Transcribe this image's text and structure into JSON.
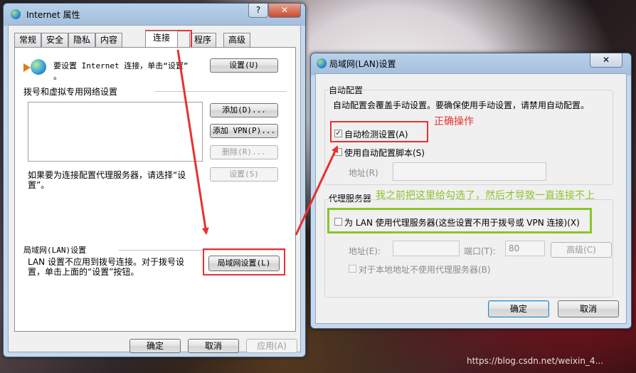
{
  "internet_props": {
    "title": "Internet 属性",
    "help_btn": "?",
    "close_btn": "✕",
    "tabs": [
      "常规",
      "安全",
      "隐私",
      "内容",
      "连接",
      "程序",
      "高级"
    ],
    "setup_text_line1": "要设置 Internet 连接，单击“设置”",
    "setup_text_line2": "。",
    "setup_btn": "设置(U)",
    "dialup_group": "拨号和虚拟专用网络设置",
    "add_btn": "添加(D)...",
    "add_vpn_btn": "添加 VPN(P)...",
    "delete_btn": "删除(R)...",
    "settings_btn": "设置(S)",
    "proxy_text_line1": "如果要为连接配置代理服务器，请选择“设",
    "proxy_text_line2": "置”。",
    "lan_group": "局域网(LAN)设置",
    "lan_text_line1": "LAN 设置不应用到拨号连接。对于拨号设",
    "lan_text_line2": "置，单击上面的“设置”按钮。",
    "lan_btn": "局域网设置(L)",
    "ok_btn": "确定",
    "cancel_btn": "取消",
    "apply_btn": "应用(A)"
  },
  "lan_dialog": {
    "title": "局域网(LAN)设置",
    "close_btn": "✕",
    "auto_group": "自动配置",
    "auto_desc": "自动配置会覆盖手动设置。要确保使用手动设置，请禁用自动配置。",
    "auto_detect": "自动检测设置(A)",
    "auto_detect_checked": true,
    "use_script": "使用自动配置脚本(S)",
    "use_script_checked": false,
    "address_label": "地址(R)",
    "proxy_group": "代理服务器",
    "use_proxy": "为 LAN 使用代理服务器(这些设置不用于拨号或 VPN 连接)(X)",
    "use_proxy_checked": false,
    "proxy_addr_label": "地址(E):",
    "port_label": "端口(T):",
    "port_value": "80",
    "advanced_btn": "高级(C)",
    "bypass_local": "对于本地地址不使用代理服务器(B)",
    "ok_btn": "确定",
    "cancel_btn": "取消"
  },
  "annotations": {
    "correct": "正确操作",
    "note": "我之前把这里给勾选了，然后才导致一直连接不上",
    "red": "#e8312f",
    "green": "#8bc42a"
  },
  "watermark": "https://blog.csdn.net/weixin_4..."
}
